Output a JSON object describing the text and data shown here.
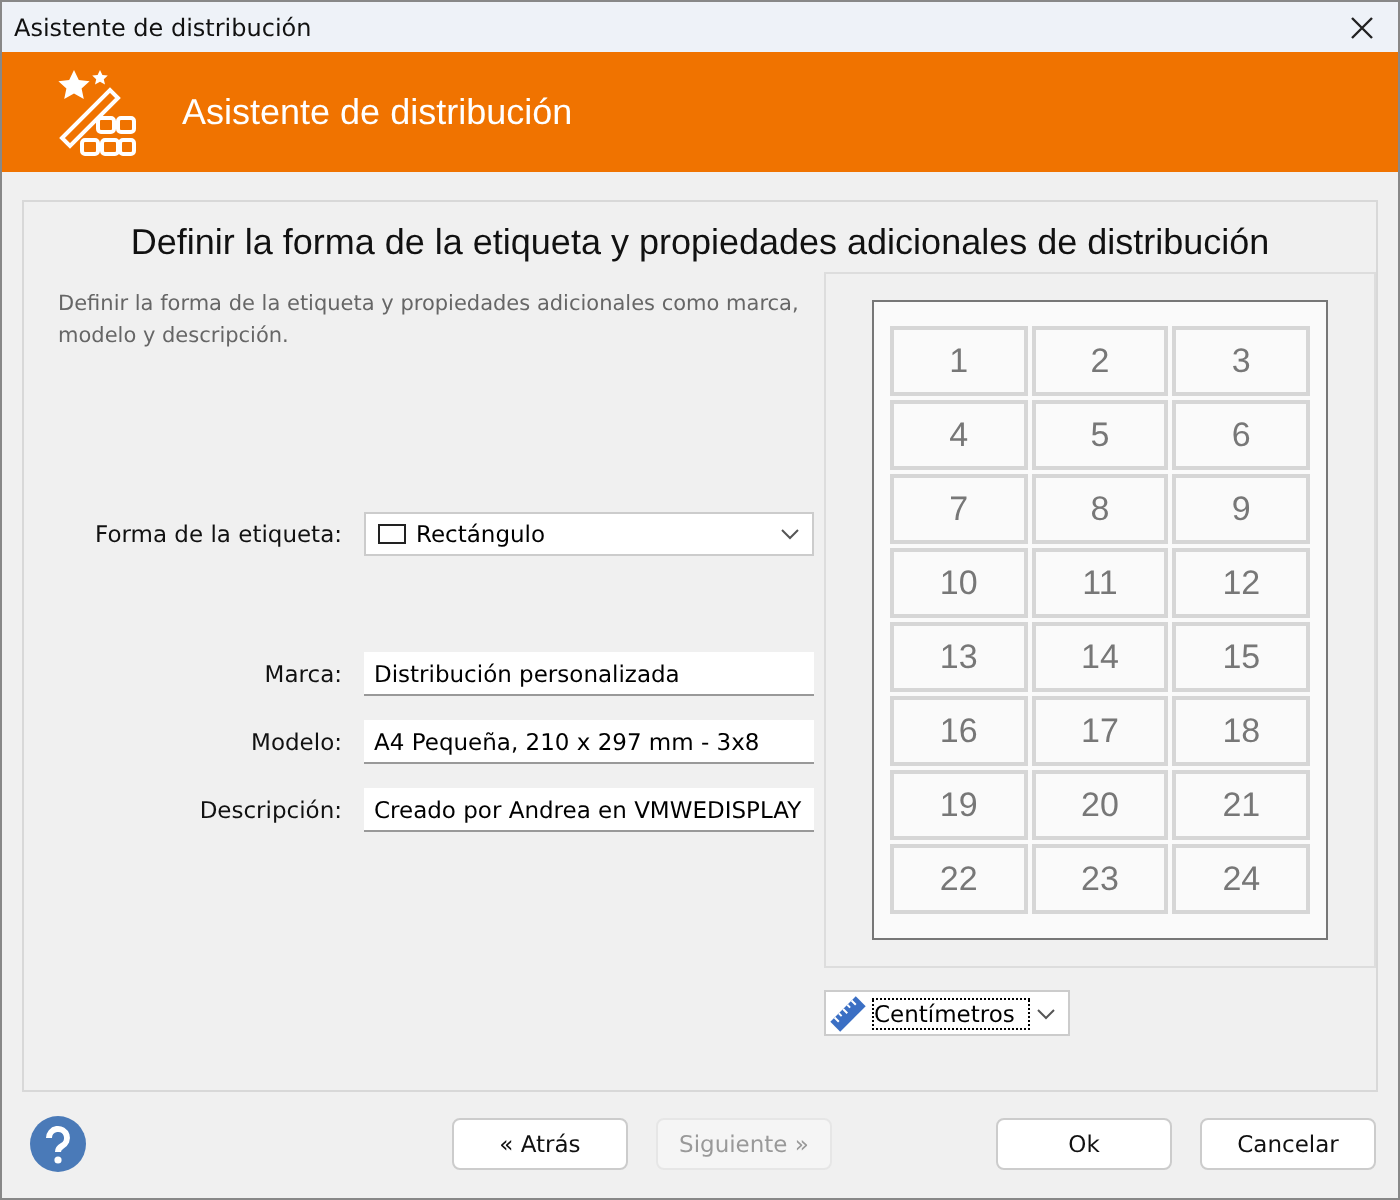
{
  "window": {
    "title": "Asistente de distribución"
  },
  "header": {
    "title": "Asistente de distribución"
  },
  "page": {
    "heading": "Definir la forma de la etiqueta y propiedades adicionales de distribución",
    "description": "Definir la forma de la etiqueta y propiedades adicionales como marca, modelo y descripción."
  },
  "shape_field": {
    "label": "Forma de la etiqueta:",
    "value": "Rectángulo"
  },
  "fields": [
    {
      "label": "Marca:",
      "value": "Distribución personalizada"
    },
    {
      "label": "Modelo:",
      "value": "A4 Pequeña, 210 x 297 mm - 3x8"
    },
    {
      "label": "Descripción:",
      "value": "Creado por Andrea en VMWEDISPLAY"
    }
  ],
  "preview": {
    "labels": [
      "1",
      "2",
      "3",
      "4",
      "5",
      "6",
      "7",
      "8",
      "9",
      "10",
      "11",
      "12",
      "13",
      "14",
      "15",
      "16",
      "17",
      "18",
      "19",
      "20",
      "21",
      "22",
      "23",
      "24"
    ]
  },
  "units": {
    "value": "Centímetros"
  },
  "buttons": [
    {
      "label": "« Atrás",
      "kind": "nav",
      "disabled": false
    },
    {
      "label": "Siguiente »",
      "kind": "nav",
      "disabled": true
    },
    {
      "label": "Ok",
      "kind": "action",
      "disabled": false
    },
    {
      "label": "Cancelar",
      "kind": "action",
      "disabled": false
    }
  ]
}
